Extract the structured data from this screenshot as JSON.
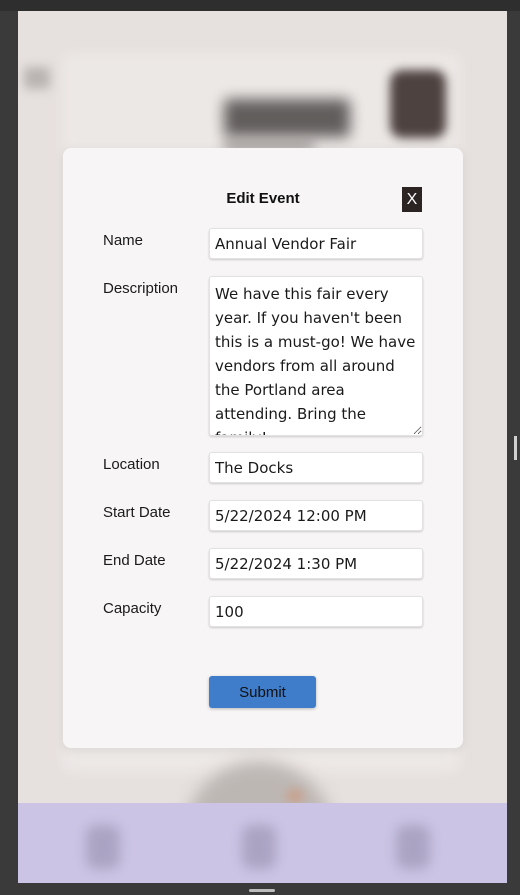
{
  "modal": {
    "title": "Edit Event",
    "close_label": "X",
    "submit_label": "Submit"
  },
  "fields": {
    "name": {
      "label": "Name",
      "value": "Annual Vendor Fair"
    },
    "description": {
      "label": "Description",
      "value": "We have this fair every year. If you haven't been this is a must-go! We have vendors from all around the Portland area attending. Bring the family!"
    },
    "location": {
      "label": "Location",
      "value": "The Docks"
    },
    "start_date": {
      "label": "Start Date",
      "value": "5/22/2024 12:00 PM"
    },
    "end_date": {
      "label": "End Date",
      "value": "5/22/2024 1:30 PM"
    },
    "capacity": {
      "label": "Capacity",
      "value": "100"
    }
  },
  "colors": {
    "submit_button": "#3f7cc9",
    "close_button": "#2b2422",
    "bottom_nav": "#cbc4e4"
  }
}
